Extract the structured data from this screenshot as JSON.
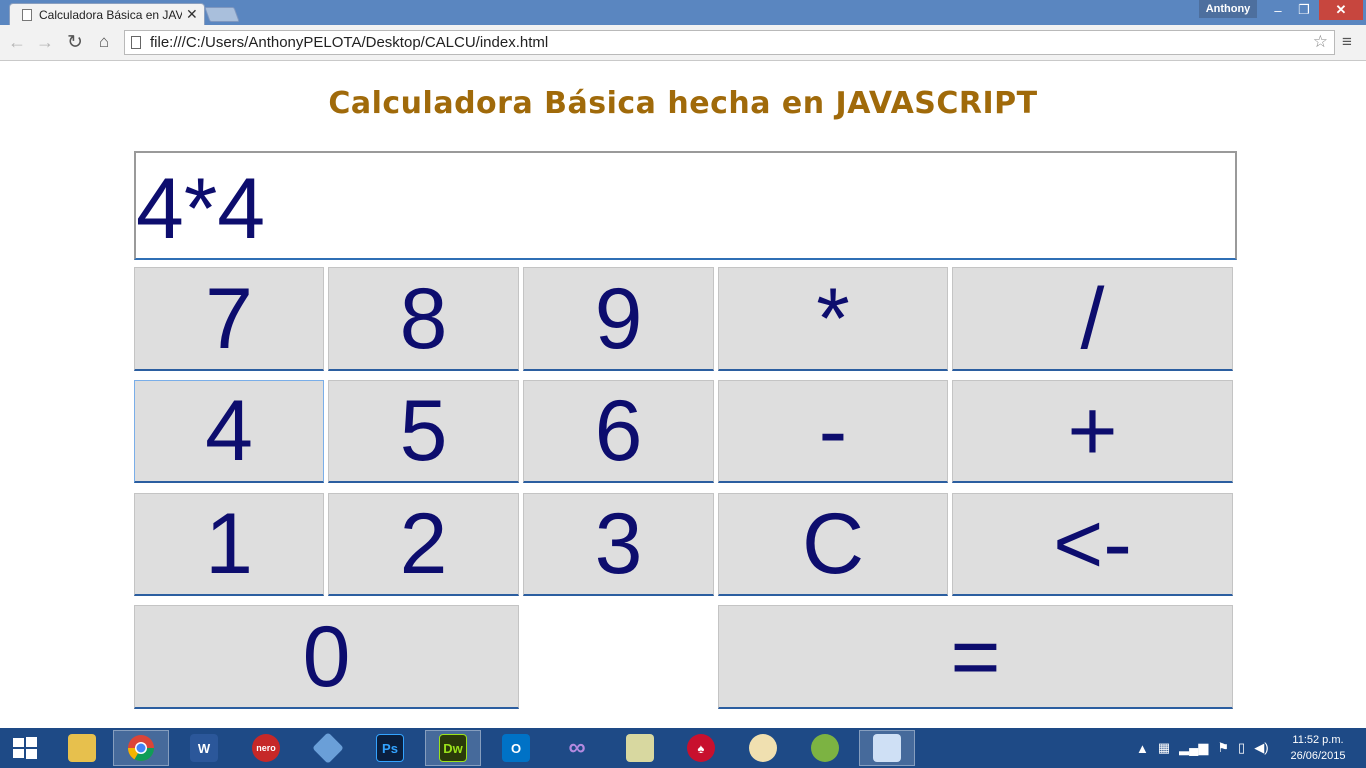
{
  "browser": {
    "tab_title": "Calculadora Básica en JAVA",
    "tab_close": "✕",
    "user_name": "Anthony",
    "url": "file:///C:/Users/AnthonyPELOTA/Desktop/CALCU/index.html",
    "window_controls": {
      "minimize": "–",
      "restore": "❐",
      "close": "✕"
    },
    "nav_icons": {
      "back": "←",
      "forward": "→",
      "reload": "↻",
      "home": "⌂",
      "star": "☆",
      "menu": "≡"
    }
  },
  "calculator": {
    "title": "Calculadora Básica hecha en JAVASCRIPT",
    "display": "4*4",
    "keys": {
      "k7": "7",
      "k8": "8",
      "k9": "9",
      "mul": "*",
      "div": "/",
      "k4": "4",
      "k5": "5",
      "k6": "6",
      "sub": "-",
      "add": "+",
      "k1": "1",
      "k2": "2",
      "k3": "3",
      "clear": "C",
      "back": "<-",
      "k0": "0",
      "equals": "="
    }
  },
  "taskbar": {
    "apps": [
      {
        "name": "windows-start",
        "label": ""
      },
      {
        "name": "file-explorer",
        "label": ""
      },
      {
        "name": "chrome",
        "label": ""
      },
      {
        "name": "word",
        "label": "W"
      },
      {
        "name": "nero",
        "label": "nero"
      },
      {
        "name": "virtualbox",
        "label": ""
      },
      {
        "name": "photoshop",
        "label": "Ps"
      },
      {
        "name": "dreamweaver",
        "label": "Dw"
      },
      {
        "name": "outlook",
        "label": "O"
      },
      {
        "name": "visual-studio",
        "label": "∞"
      },
      {
        "name": "scanner-app",
        "label": ""
      },
      {
        "name": "pokerstars",
        "label": "♠"
      },
      {
        "name": "paint",
        "label": ""
      },
      {
        "name": "android-studio",
        "label": ""
      },
      {
        "name": "control-panel",
        "label": ""
      }
    ],
    "tray": {
      "chevron": "▲",
      "clock_time": "11:52 p.m.",
      "clock_date": "26/06/2015"
    }
  },
  "colors": {
    "title_brown": "#a06a0a",
    "digit_navy": "#0d0d6e",
    "key_gray": "#dedede",
    "key_border_blue": "#2b5ea0",
    "taskbar_blue": "#1e4a86",
    "titlebar_blue": "#5a86c0"
  }
}
